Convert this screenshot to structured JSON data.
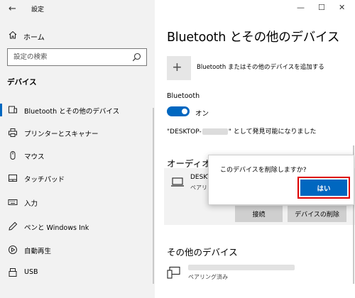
{
  "window": {
    "title": "設定",
    "minimize": "—",
    "maximize": "☐",
    "close": "✕"
  },
  "sidebar": {
    "home_label": "ホーム",
    "search_placeholder": "設定の検索",
    "section_title": "デバイス",
    "items": [
      {
        "label": "Bluetooth とその他のデバイス",
        "icon": "bluetooth-devices-icon",
        "active": true
      },
      {
        "label": "プリンターとスキャナー",
        "icon": "printer-icon",
        "active": false
      },
      {
        "label": "マウス",
        "icon": "mouse-icon",
        "active": false
      },
      {
        "label": "タッチパッド",
        "icon": "touchpad-icon",
        "active": false
      },
      {
        "label": "入力",
        "icon": "keyboard-icon",
        "active": false
      },
      {
        "label": "ペンと Windows Ink",
        "icon": "pen-icon",
        "active": false
      },
      {
        "label": "自動再生",
        "icon": "autoplay-icon",
        "active": false
      },
      {
        "label": "USB",
        "icon": "usb-icon",
        "active": false
      }
    ]
  },
  "main": {
    "title": "Bluetooth とその他のデバイス",
    "add_symbol": "+",
    "add_label": "Bluetooth またはその他のデバイスを追加する",
    "bluetooth_label": "Bluetooth",
    "toggle_state": "オン",
    "discover_prefix": "\"DESKTOP-",
    "discover_suffix": "\" として発見可能になりました",
    "audio_heading": "オーディオ",
    "audio_device": {
      "name": "DESKT",
      "status": "ペアリン",
      "connect_label": "接続",
      "remove_label": "デバイスの削除"
    },
    "other_heading": "その他のデバイス",
    "other_device": {
      "status": "ペアリング済み"
    }
  },
  "popup": {
    "message": "このデバイスを削除しますか?",
    "yes_label": "はい"
  },
  "colors": {
    "accent": "#0067c0",
    "highlight": "#e00000",
    "sidebar_bg": "#f2f2f2"
  }
}
